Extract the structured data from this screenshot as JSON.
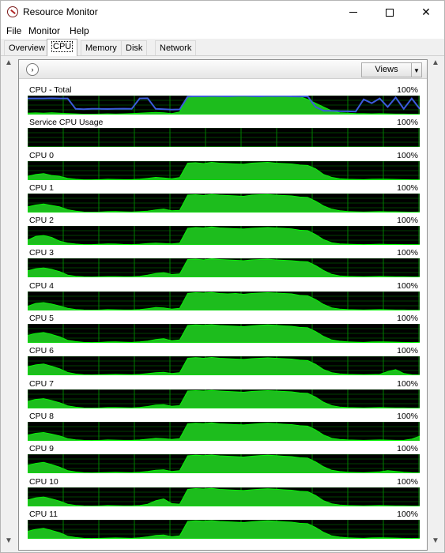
{
  "window": {
    "title": "Resource Monitor",
    "controls": {
      "minimize": "",
      "maximize": "",
      "close": "✕"
    }
  },
  "menu": {
    "items": [
      {
        "label": "File"
      },
      {
        "label": "Monitor"
      },
      {
        "label": "Help"
      }
    ]
  },
  "tabs": [
    {
      "label": "Overview",
      "active": false
    },
    {
      "label": "CPU",
      "active": true
    },
    {
      "label": "Memory",
      "active": false
    },
    {
      "label": "Disk",
      "active": false
    },
    {
      "label": "Network",
      "active": false
    }
  ],
  "panel": {
    "expand_icon": "›",
    "views_label": "Views",
    "views_dropdown_icon": "▼"
  },
  "scroll": {
    "up": "▲",
    "down": "▼"
  },
  "colors": {
    "graph_bg": "#000000",
    "grid": "#008000",
    "usage_fill": "#1dbd1d",
    "usage_line": "#00ff00",
    "frequency_line": "#3b5bdb"
  },
  "chart_data": [
    {
      "type": "area",
      "title": "CPU - Total",
      "max_label": "100%",
      "values": [
        8,
        9,
        8,
        10,
        8,
        6,
        4,
        2,
        2,
        3,
        4,
        3,
        4,
        6,
        8,
        10,
        12,
        10,
        6,
        14,
        96,
        97,
        96,
        98,
        97,
        96,
        98,
        99,
        97,
        96,
        98,
        97,
        98,
        96,
        95,
        80,
        60,
        40,
        20,
        10,
        8,
        6,
        5,
        4,
        5,
        4,
        3,
        3,
        2,
        2
      ],
      "freq": [
        85,
        85,
        85,
        86,
        85,
        85,
        30,
        28,
        30,
        30,
        29,
        30,
        31,
        30,
        85,
        86,
        30,
        28,
        26,
        27,
        94,
        97,
        96,
        98,
        97,
        96,
        98,
        99,
        97,
        96,
        98,
        97,
        98,
        96,
        95,
        96,
        40,
        20,
        20,
        18,
        17,
        16,
        80,
        60,
        85,
        40,
        90,
        30,
        85,
        30
      ]
    },
    {
      "type": "area",
      "title": "Service CPU Usage",
      "max_label": "100%",
      "values": [
        0,
        0,
        0,
        0,
        0,
        0,
        0,
        0,
        0,
        0,
        0,
        0,
        0,
        0,
        0,
        0,
        0,
        0,
        0,
        0,
        0,
        0,
        0,
        0,
        0,
        0,
        0,
        0,
        0,
        0,
        0,
        0,
        0,
        0,
        0,
        0,
        0,
        0,
        0,
        0,
        0,
        0,
        0,
        0,
        0,
        0,
        0,
        0,
        0,
        0
      ]
    },
    {
      "type": "area",
      "title": "CPU 0",
      "max_label": "100%",
      "values": [
        20,
        30,
        35,
        25,
        20,
        10,
        5,
        2,
        2,
        3,
        5,
        4,
        3,
        3,
        6,
        10,
        15,
        12,
        8,
        14,
        90,
        92,
        88,
        94,
        90,
        88,
        86,
        84,
        90,
        92,
        94,
        90,
        88,
        86,
        80,
        78,
        60,
        30,
        15,
        8,
        5,
        4,
        3,
        5,
        6,
        5,
        4,
        3,
        2,
        2
      ]
    },
    {
      "type": "area",
      "title": "CPU 1",
      "max_label": "100%",
      "values": [
        30,
        40,
        45,
        38,
        30,
        15,
        8,
        3,
        2,
        3,
        5,
        6,
        4,
        3,
        5,
        8,
        14,
        18,
        10,
        12,
        92,
        94,
        90,
        96,
        92,
        90,
        88,
        86,
        92,
        94,
        95,
        92,
        90,
        88,
        82,
        80,
        60,
        35,
        18,
        10,
        6,
        4,
        3,
        4,
        5,
        4,
        4,
        3,
        2,
        3
      ]
    },
    {
      "type": "area",
      "title": "CPU 2",
      "max_label": "100%",
      "values": [
        25,
        45,
        50,
        40,
        20,
        10,
        5,
        2,
        2,
        4,
        6,
        5,
        3,
        2,
        4,
        8,
        10,
        8,
        6,
        10,
        88,
        92,
        90,
        95,
        90,
        88,
        86,
        84,
        88,
        90,
        92,
        90,
        88,
        85,
        78,
        76,
        55,
        28,
        12,
        6,
        4,
        3,
        2,
        3,
        4,
        3,
        3,
        2,
        2,
        2
      ]
    },
    {
      "type": "area",
      "title": "CPU 3",
      "max_label": "100%",
      "values": [
        35,
        45,
        50,
        42,
        30,
        12,
        6,
        3,
        2,
        3,
        4,
        4,
        3,
        3,
        6,
        12,
        20,
        25,
        15,
        18,
        94,
        96,
        92,
        97,
        94,
        92,
        90,
        88,
        92,
        94,
        96,
        92,
        90,
        88,
        84,
        82,
        62,
        36,
        16,
        8,
        5,
        4,
        3,
        4,
        5,
        4,
        3,
        3,
        2,
        2
      ]
    },
    {
      "type": "area",
      "title": "CPU 4",
      "max_label": "100%",
      "values": [
        22,
        38,
        42,
        34,
        24,
        12,
        6,
        3,
        2,
        3,
        5,
        4,
        3,
        3,
        5,
        10,
        16,
        14,
        8,
        12,
        90,
        94,
        92,
        95,
        90,
        88,
        90,
        86,
        90,
        92,
        94,
        92,
        90,
        88,
        80,
        78,
        58,
        32,
        14,
        8,
        5,
        4,
        3,
        4,
        5,
        4,
        3,
        3,
        2,
        2
      ]
    },
    {
      "type": "area",
      "title": "CPU 5",
      "max_label": "100%",
      "values": [
        40,
        50,
        55,
        45,
        32,
        14,
        7,
        3,
        2,
        3,
        5,
        6,
        4,
        3,
        6,
        10,
        18,
        22,
        12,
        16,
        92,
        95,
        93,
        96,
        92,
        90,
        88,
        86,
        90,
        93,
        95,
        93,
        90,
        88,
        82,
        80,
        60,
        34,
        16,
        9,
        6,
        4,
        3,
        5,
        6,
        5,
        4,
        3,
        2,
        3
      ]
    },
    {
      "type": "area",
      "title": "CPU 6",
      "max_label": "100%",
      "values": [
        45,
        55,
        60,
        48,
        34,
        15,
        7,
        3,
        2,
        3,
        4,
        5,
        4,
        3,
        5,
        9,
        14,
        16,
        10,
        14,
        90,
        93,
        90,
        94,
        90,
        88,
        86,
        84,
        88,
        90,
        92,
        90,
        88,
        86,
        80,
        78,
        58,
        30,
        14,
        8,
        5,
        4,
        3,
        4,
        5,
        20,
        30,
        10,
        3,
        2
      ]
    },
    {
      "type": "area",
      "title": "CPU 7",
      "max_label": "100%",
      "values": [
        38,
        48,
        52,
        42,
        30,
        14,
        7,
        3,
        2,
        3,
        5,
        5,
        4,
        3,
        6,
        11,
        18,
        20,
        12,
        15,
        92,
        94,
        92,
        95,
        92,
        90,
        88,
        86,
        90,
        92,
        94,
        92,
        90,
        88,
        82,
        80,
        60,
        33,
        15,
        8,
        5,
        4,
        3,
        4,
        5,
        4,
        3,
        3,
        2,
        2
      ]
    },
    {
      "type": "area",
      "title": "CPU 8",
      "max_label": "100%",
      "values": [
        30,
        40,
        44,
        36,
        26,
        12,
        6,
        3,
        2,
        3,
        5,
        4,
        3,
        3,
        5,
        9,
        14,
        12,
        8,
        12,
        90,
        93,
        91,
        95,
        90,
        88,
        86,
        84,
        88,
        91,
        93,
        91,
        88,
        86,
        80,
        78,
        58,
        31,
        14,
        8,
        5,
        4,
        3,
        4,
        5,
        4,
        3,
        3,
        10,
        25
      ]
    },
    {
      "type": "area",
      "title": "CPU 9",
      "max_label": "100%",
      "values": [
        42,
        52,
        58,
        46,
        32,
        14,
        7,
        3,
        2,
        3,
        4,
        5,
        4,
        3,
        6,
        10,
        16,
        18,
        10,
        14,
        92,
        95,
        93,
        96,
        92,
        90,
        88,
        86,
        90,
        93,
        95,
        93,
        90,
        88,
        82,
        80,
        60,
        34,
        16,
        9,
        6,
        4,
        3,
        5,
        8,
        14,
        10,
        6,
        3,
        2
      ]
    },
    {
      "type": "area",
      "title": "CPU 10",
      "max_label": "100%",
      "values": [
        35,
        45,
        50,
        40,
        28,
        12,
        6,
        3,
        2,
        3,
        5,
        4,
        3,
        3,
        5,
        12,
        30,
        40,
        15,
        12,
        90,
        94,
        92,
        95,
        90,
        88,
        86,
        84,
        88,
        91,
        93,
        91,
        88,
        86,
        80,
        78,
        58,
        30,
        14,
        8,
        5,
        4,
        3,
        4,
        5,
        4,
        3,
        3,
        2,
        2
      ]
    },
    {
      "type": "area",
      "title": "CPU 11",
      "max_label": "100%",
      "values": [
        40,
        50,
        56,
        44,
        32,
        14,
        7,
        3,
        2,
        3,
        4,
        5,
        4,
        3,
        6,
        11,
        18,
        20,
        12,
        16,
        92,
        95,
        93,
        96,
        92,
        90,
        88,
        86,
        90,
        93,
        95,
        93,
        90,
        88,
        82,
        80,
        60,
        34,
        16,
        9,
        6,
        4,
        3,
        5,
        6,
        5,
        4,
        3,
        2,
        3
      ]
    }
  ]
}
